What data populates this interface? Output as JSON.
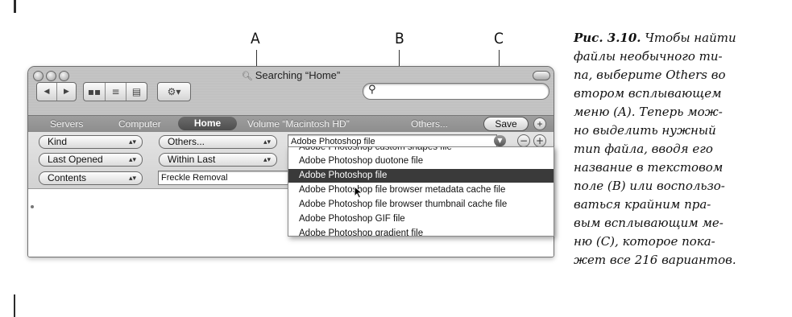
{
  "figure": {
    "callouts": [
      "A",
      "B",
      "C"
    ],
    "caption_label": "Рис. 3.10.",
    "caption_lines": [
      "Чтобы найти",
      "файлы необычного ти-",
      "па, выберите Others во",
      "втором всплывающем",
      "меню (A). Теперь мож-",
      "но выделить нужный",
      "тип файла, вводя его",
      "название в текстовом",
      "поле (B) или воспользо-",
      "ваться крайним пра-",
      "вым всплывающим ме-",
      "ню (C), которое пока-",
      "жет все 216 вариантов."
    ]
  },
  "window": {
    "title": "Searching “Home”",
    "search_placeholder": "",
    "toolbar": {
      "back_label": "◀",
      "forward_label": "▶",
      "action_label": "⚙▾"
    },
    "scopes": {
      "servers": "Servers",
      "computer": "Computer",
      "home": "Home",
      "volume": "Volume “Macintosh HD”",
      "others": "Others...",
      "save": "Save"
    },
    "criteria": [
      {
        "attribute": "Kind",
        "operator": "Others...",
        "value": "Adobe Photoshop file"
      },
      {
        "attribute": "Last Opened",
        "operator": "Within Last",
        "value": ""
      },
      {
        "attribute": "Contents",
        "operator": "",
        "value": "Freckle Removal"
      }
    ],
    "type_menu": {
      "items": [
        "Adobe Photoshop custom shapes file",
        "Adobe Photoshop duotone file",
        "Adobe Photoshop file",
        "Adobe Photoshop file browser metadata cache file",
        "Adobe Photoshop file browser thumbnail cache file",
        "Adobe Photoshop GIF file",
        "Adobe Photoshop gradient file"
      ],
      "selected_index": 2
    }
  }
}
